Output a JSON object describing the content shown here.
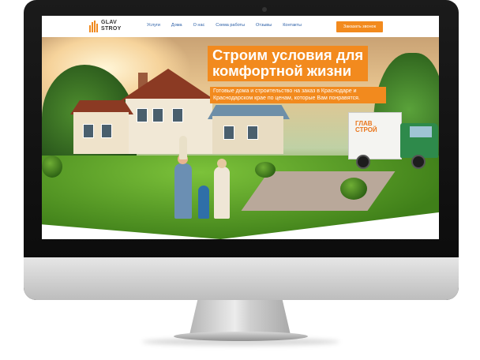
{
  "site": {
    "logo_line1": "GLAV",
    "logo_line2": "STROY",
    "nav": [
      "Услуги",
      "Дома",
      "О нас",
      "Схема работы",
      "Отзывы",
      "Контакты"
    ],
    "order_button": "Заказать звонок"
  },
  "hero": {
    "headline_line1": "Строим условия для",
    "headline_line2": "комфортной жизни",
    "subline": "Готовые дома и строительство на заказ в Краснодаре и Краснодарском крае по ценам, которые Вам понравятся.",
    "truck_logo_line1": "ГЛАВ",
    "truck_logo_line2": "СТРОЙ"
  },
  "colors": {
    "accent": "#f28a1e",
    "nav": "#2a5ea6",
    "bezel": "#111111"
  },
  "icons": {
    "logo": "building-logo-icon"
  }
}
